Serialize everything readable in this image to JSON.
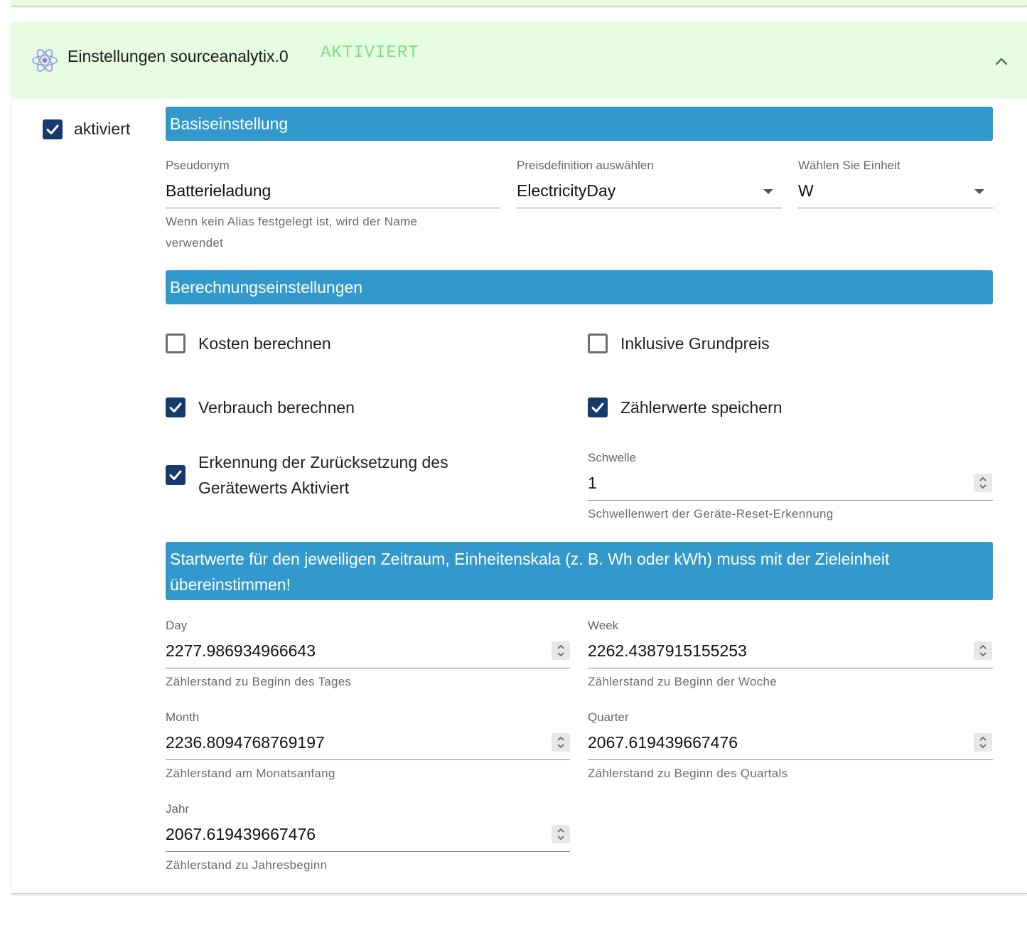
{
  "header": {
    "title": "Einstellungen sourceanalytix.0",
    "status": "AKTIVIERT",
    "icon": "atom-icon",
    "collapse_icon": "chevron-up-icon"
  },
  "enabled": {
    "label": "aktiviert",
    "checked": true
  },
  "sections": {
    "basic": "Basiseinstellung",
    "calc": "Berechnungseinstellungen",
    "start": "Startwerte für den jeweiligen Zeitraum, Einheitenskala (z. B. Wh oder kWh) muss mit der Zieleinheit übereinstimmen!"
  },
  "basic": {
    "alias": {
      "label": "Pseudonym",
      "value": "Batterieladung",
      "help": "Wenn kein Alias festgelegt ist, wird der Name verwendet"
    },
    "price": {
      "label": "Preisdefinition auswählen",
      "value": "ElectricityDay"
    },
    "unit": {
      "label": "Wählen Sie Einheit",
      "value": "W"
    }
  },
  "calc": {
    "costs": {
      "label": "Kosten berechnen",
      "checked": false
    },
    "base_price": {
      "label": "Inklusive Grundpreis",
      "checked": false
    },
    "consumption": {
      "label": "Verbrauch berechnen",
      "checked": true
    },
    "meter_values": {
      "label": "Zählerwerte speichern",
      "checked": true
    },
    "reset_detection": {
      "label": "Erkennung der Zurücksetzung des Gerätewerts Aktiviert",
      "checked": true
    },
    "threshold": {
      "label": "Schwelle",
      "value": "1",
      "help": "Schwellenwert der Geräte-Reset-Erkennung"
    }
  },
  "start_values": {
    "day": {
      "label": "Day",
      "value": "2277.986934966643",
      "help": "Zählerstand zu Beginn des Tages"
    },
    "week": {
      "label": "Week",
      "value": "2262.4387915155253",
      "help": "Zählerstand zu Beginn der Woche"
    },
    "month": {
      "label": "Month",
      "value": "2236.8094768769197",
      "help": "Zählerstand am Monatsanfang"
    },
    "quarter": {
      "label": "Quarter",
      "value": "2067.619439667476",
      "help": "Zählerstand zu Beginn des Quartals"
    },
    "year": {
      "label": "Jahr",
      "value": "2067.619439667476",
      "help": "Zählerstand zu Jahresbeginn"
    }
  },
  "colors": {
    "header_bg": "#e6fde2",
    "status": "#7fe07f",
    "section_bar": "#3399cc",
    "checkbox": "#163a6b"
  }
}
